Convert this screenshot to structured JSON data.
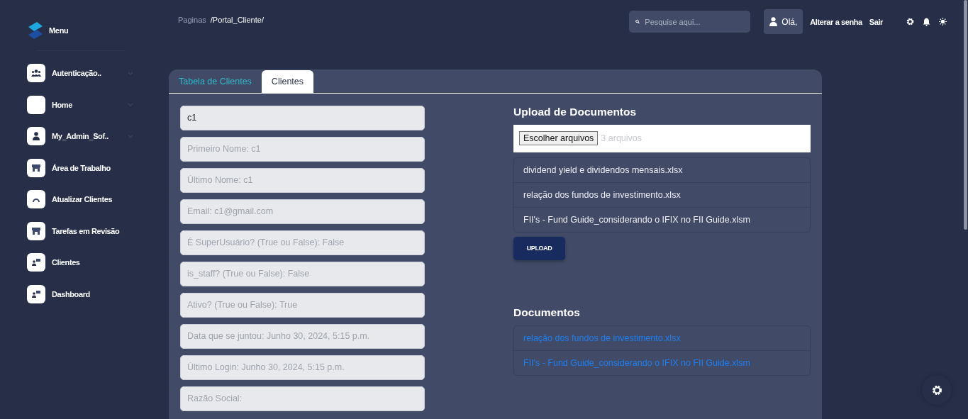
{
  "sidebar": {
    "title": "Menu",
    "items": [
      {
        "label": "Autenticação..",
        "kind": "users",
        "has_submenu": true
      },
      {
        "label": "Home",
        "kind": "blank",
        "has_submenu": true
      },
      {
        "label": "My_Admin_Sof..",
        "kind": "user",
        "has_submenu": true
      },
      {
        "label": "Área de Trabalho",
        "kind": "store",
        "has_submenu": false
      },
      {
        "label": "Atualizar Clientes",
        "kind": "arc",
        "has_submenu": false
      },
      {
        "label": "Tarefas em Revisão",
        "kind": "store",
        "has_submenu": false
      },
      {
        "label": "Clientes",
        "kind": "client",
        "has_submenu": false
      },
      {
        "label": "Dashboard",
        "kind": "client",
        "has_submenu": false
      }
    ]
  },
  "header": {
    "breadcrumb_label": "Paginas",
    "breadcrumb_path": "/Portal_Cliente/",
    "search": {
      "placeholder": "Pesquise aqui..."
    },
    "greeting": "Olá,",
    "links": [
      "Alterar a senha",
      "Sair"
    ]
  },
  "tabs": [
    {
      "label": "Tabela de Clientes",
      "selected": false
    },
    {
      "label": "Clientes",
      "selected": true
    }
  ],
  "form_fields": [
    {
      "value": "c1"
    },
    {
      "placeholder": "Primeiro Nome: c1"
    },
    {
      "placeholder": "Último Nome: c1"
    },
    {
      "placeholder": "Email: c1@gmail.com"
    },
    {
      "placeholder": "É SuperUsuário? (True ou False): False"
    },
    {
      "placeholder": "is_staff? (True ou False): False"
    },
    {
      "placeholder": "Ativo? (True ou False): True"
    },
    {
      "placeholder": "Data que se juntou: Junho 30, 2024, 5:15 p.m."
    },
    {
      "placeholder": "Último Login: Junho 30, 2024, 5:15 p.m."
    },
    {
      "placeholder": "Razão Social:"
    }
  ],
  "upload": {
    "title": "Upload de Documentos",
    "choose_button": "Escolher arquivos",
    "file_count": "3 arquivos",
    "files": [
      "dividend yield e dividendos mensais.xlsx",
      "relação dos fundos de investimento.xlsx",
      "FII's - Fund Guide_considerando o IFIX no FII Guide.xlsm"
    ],
    "button": "UPLOAD"
  },
  "documents": {
    "title": "Documentos",
    "links": [
      "relação dos fundos de investimento.xlsx",
      "FII's - Fund Guide_considerando o IFIX no FII Guide.xlsm"
    ]
  }
}
